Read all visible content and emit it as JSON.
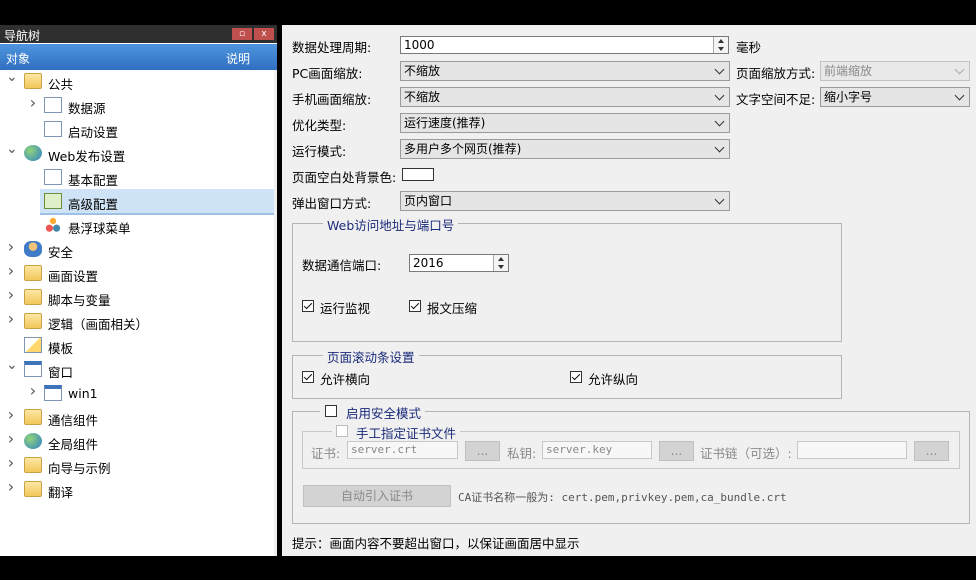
{
  "nav": {
    "title": "导航树",
    "col_object": "对象",
    "col_desc": "说明",
    "items": [
      {
        "label": "公共",
        "icon": "folder-icon",
        "expand": "open"
      },
      {
        "label": "数据源",
        "icon": "datasource-icon",
        "expand": "closed"
      },
      {
        "label": "启动设置",
        "icon": "startup-icon",
        "expand": "none"
      },
      {
        "label": "Web发布设置",
        "icon": "globe-icon",
        "expand": "open"
      },
      {
        "label": "基本配置",
        "icon": "config-icon",
        "expand": "none"
      },
      {
        "label": "高级配置",
        "icon": "advanced-config-icon",
        "expand": "none",
        "selected": true
      },
      {
        "label": "悬浮球菜单",
        "icon": "float-menu-icon",
        "expand": "none"
      },
      {
        "label": "安全",
        "icon": "users-icon",
        "expand": "closed"
      },
      {
        "label": "画面设置",
        "icon": "folder-icon",
        "expand": "closed"
      },
      {
        "label": "脚本与变量",
        "icon": "folder-icon",
        "expand": "closed"
      },
      {
        "label": "逻辑（画面相关）",
        "icon": "folder-icon",
        "expand": "closed"
      },
      {
        "label": "模板",
        "icon": "template-icon",
        "expand": "none"
      },
      {
        "label": "窗口",
        "icon": "window-icon",
        "expand": "open"
      },
      {
        "label": "win1",
        "icon": "window-doc-icon",
        "expand": "closed"
      },
      {
        "label": "通信组件",
        "icon": "folder-icon",
        "expand": "closed"
      },
      {
        "label": "全局组件",
        "icon": "globe-icon",
        "expand": "closed"
      },
      {
        "label": "向导与示例",
        "icon": "folder-icon",
        "expand": "closed"
      },
      {
        "label": "翻译",
        "icon": "folder-icon",
        "expand": "closed"
      }
    ]
  },
  "form": {
    "period_label": "数据处理周期:",
    "period_value": "1000",
    "period_unit": "毫秒",
    "pc_zoom_label": "PC画面缩放:",
    "pc_zoom_value": "不缩放",
    "page_zoom_mode_label": "页面缩放方式:",
    "page_zoom_mode_value": "前端缩放",
    "mobile_zoom_label": "手机画面缩放:",
    "mobile_zoom_value": "不缩放",
    "text_overflow_label": "文字空间不足:",
    "text_overflow_value": "缩小字号",
    "optimize_label": "优化类型:",
    "optimize_value": "运行速度(推荐)",
    "run_mode_label": "运行模式:",
    "run_mode_value": "多用户多个网页(推荐)",
    "bg_color_label": "页面空白处背景色:",
    "popup_label": "弹出窗口方式:",
    "popup_value": "页内窗口"
  },
  "web_group": {
    "title": "Web访问地址与端口号",
    "port_label": "数据通信端口:",
    "port_value": "2016",
    "monitor_label": "运行监视",
    "monitor_checked": true,
    "compress_label": "报文压缩",
    "compress_checked": true
  },
  "scroll_group": {
    "title": "页面滚动条设置",
    "horizontal_label": "允许横向",
    "horizontal_checked": true,
    "vertical_label": "允许纵向",
    "vertical_checked": true
  },
  "security_group": {
    "enable_label": "启用安全模式",
    "enable_checked": false,
    "manual_cert_label": "手工指定证书文件",
    "manual_cert_checked": false,
    "cert_label": "证书:",
    "cert_value": "server.crt",
    "key_label": "私钥:",
    "key_value": "server.key",
    "chain_label": "证书链（可选）:",
    "chain_value": "",
    "browse_label": "...",
    "auto_import_label": "自动引入证书",
    "ca_hint": "CA证书名称一般为: cert.pem,privkey.pem,ca_bundle.crt"
  },
  "tip": "提示：画面内容不要超出窗口，以保证画面居中显示",
  "colors": {
    "header_blue": "#3b7fcf",
    "selected_bg": "#cfe3f6",
    "group_title": "#1a2a7a",
    "page_bg_swatch": "#ffffff"
  }
}
